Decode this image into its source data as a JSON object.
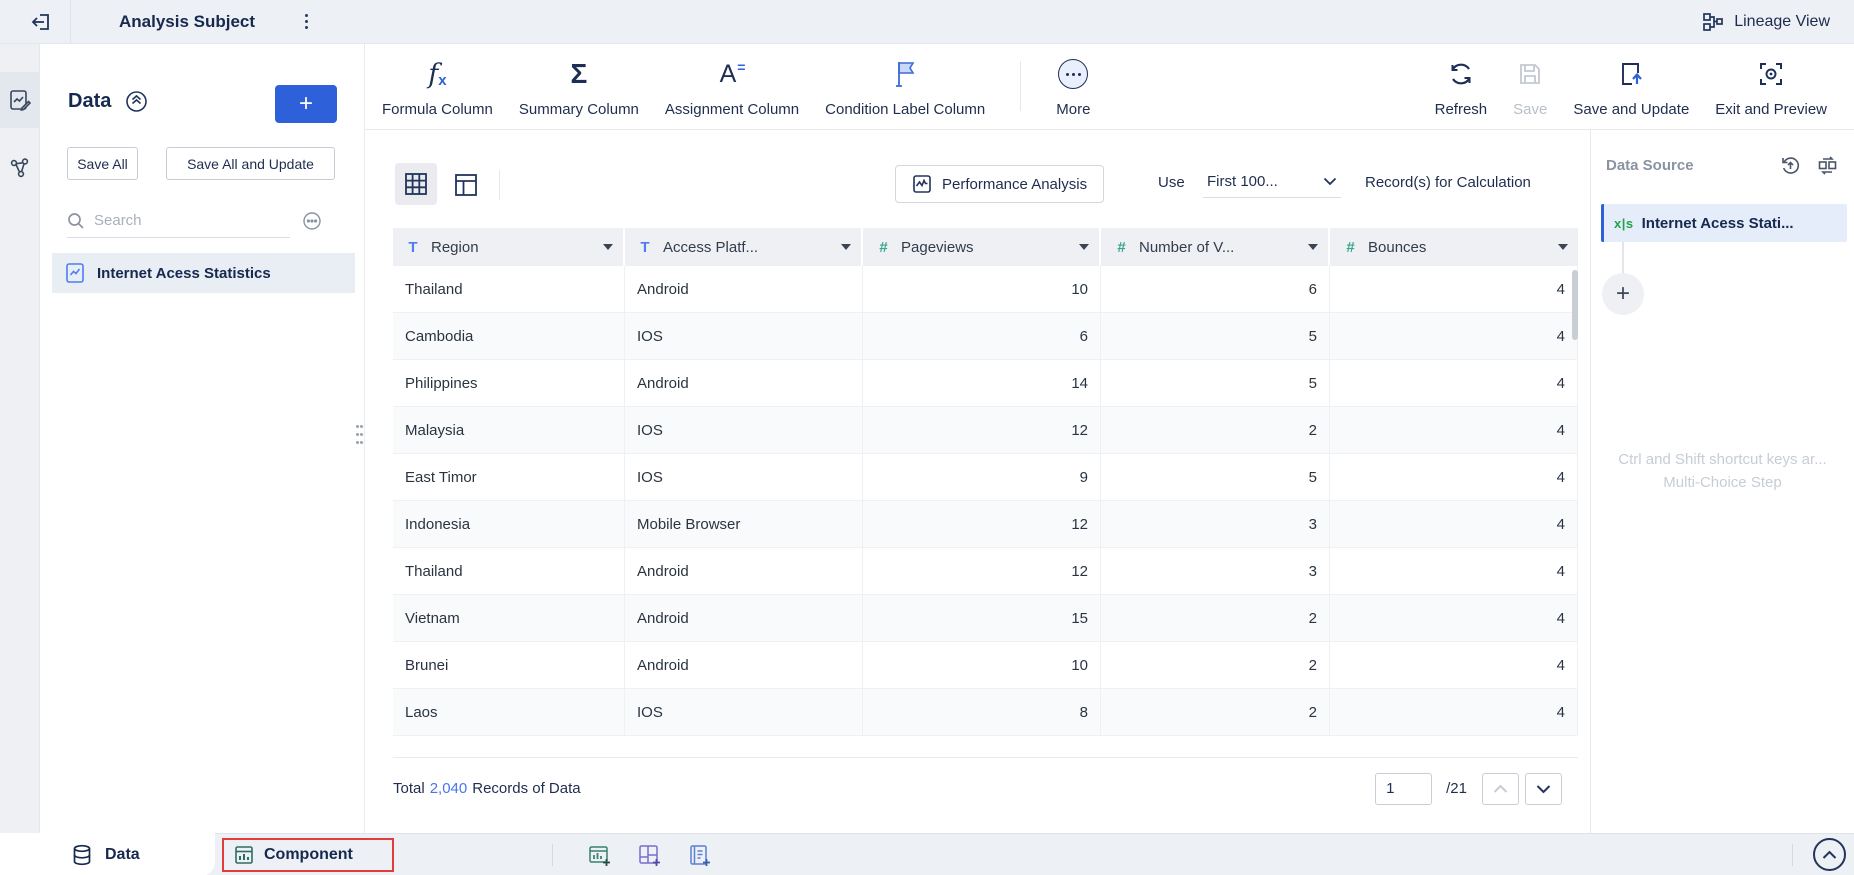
{
  "topbar": {
    "title": "Analysis Subject",
    "lineage_label": "Lineage View"
  },
  "toolbar": {
    "formula_label": "Formula Column",
    "summary_label": "Summary Column",
    "assignment_label": "Assignment Column",
    "condition_label": "Condition Label Column",
    "more_label": "More",
    "refresh_label": "Refresh",
    "save_label": "Save",
    "save_update_label": "Save and Update",
    "exit_preview_label": "Exit and Preview"
  },
  "left_panel": {
    "title": "Data",
    "save_all_label": "Save All",
    "save_all_update_label": "Save All and Update",
    "search_placeholder": "Search",
    "dataset_label": "Internet Acess Statistics"
  },
  "controls": {
    "performance_label": "Performance Analysis",
    "use_label": "Use",
    "sample_value": "First 100...",
    "records_label": "Record(s) for Calculation"
  },
  "table": {
    "columns": [
      {
        "name": "Region",
        "type": "text"
      },
      {
        "name": "Access Platf...",
        "type": "text"
      },
      {
        "name": "Pageviews",
        "type": "number"
      },
      {
        "name": "Number of V...",
        "type": "number"
      },
      {
        "name": "Bounces",
        "type": "number"
      }
    ],
    "rows": [
      [
        "Thailand",
        "Android",
        "10",
        "6",
        "4"
      ],
      [
        "Cambodia",
        "IOS",
        "6",
        "5",
        "4"
      ],
      [
        "Philippines",
        "Android",
        "14",
        "5",
        "4"
      ],
      [
        "Malaysia",
        "IOS",
        "12",
        "2",
        "4"
      ],
      [
        "East Timor",
        "IOS",
        "9",
        "5",
        "4"
      ],
      [
        "Indonesia",
        "Mobile Browser",
        "12",
        "3",
        "4"
      ],
      [
        "Thailand",
        "Android",
        "12",
        "3",
        "4"
      ],
      [
        "Vietnam",
        "Android",
        "15",
        "2",
        "4"
      ],
      [
        "Brunei",
        "Android",
        "10",
        "2",
        "4"
      ],
      [
        "Laos",
        "IOS",
        "8",
        "2",
        "4"
      ]
    ]
  },
  "footer": {
    "total_prefix": "Total",
    "total_count": "2,040",
    "total_suffix": "Records of Data",
    "page_value": "1",
    "page_total": "/21"
  },
  "right_panel": {
    "title": "Data Source",
    "source_badge": "x|s",
    "source_label": "Internet Acess Stati...",
    "add_step_label": "+",
    "hint_line1": "Ctrl and Shift shortcut keys ar...",
    "hint_line2": "Multi-Choice Step"
  },
  "bottom_bar": {
    "data_tab_label": "Data",
    "component_tab_label": "Component"
  },
  "colors": {
    "accent_blue": "#2e61d9",
    "link_blue": "#4a74e8",
    "numeric_teal": "#3aa592",
    "text_column_blue": "#4e7ff0",
    "xls_green": "#21a24b",
    "annotation_red": "#e23b3b",
    "navy_text": "#16294e"
  }
}
